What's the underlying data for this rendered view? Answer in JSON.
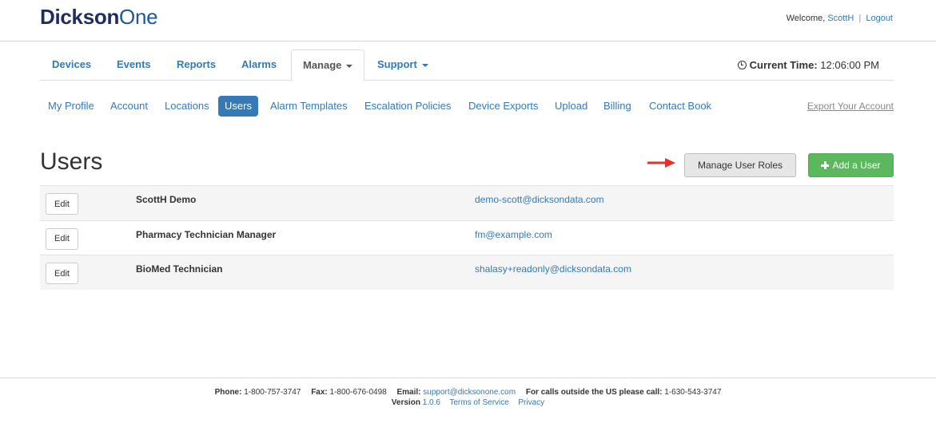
{
  "header": {
    "logo_bold": "Dickson",
    "logo_light": "One",
    "welcome_text": "Welcome,",
    "user_link": "ScottH",
    "separator": "|",
    "logout_link": "Logout"
  },
  "main_nav": {
    "tabs": [
      {
        "label": "Devices"
      },
      {
        "label": "Events"
      },
      {
        "label": "Reports"
      },
      {
        "label": "Alarms"
      },
      {
        "label": "Manage",
        "active": true,
        "dropdown": true
      },
      {
        "label": "Support",
        "dropdown": true
      }
    ],
    "clock_label": "Current Time:",
    "clock_value": "12:06:00 PM"
  },
  "sub_nav": {
    "items": [
      {
        "label": "My Profile"
      },
      {
        "label": "Account"
      },
      {
        "label": "Locations"
      },
      {
        "label": "Users",
        "active": true
      },
      {
        "label": "Alarm Templates"
      },
      {
        "label": "Escalation Policies"
      },
      {
        "label": "Device Exports"
      },
      {
        "label": "Upload"
      },
      {
        "label": "Billing"
      },
      {
        "label": "Contact Book"
      }
    ],
    "export_link": "Export Your Account"
  },
  "page": {
    "title": "Users",
    "manage_roles_label": "Manage User Roles",
    "add_user_label": "Add a User"
  },
  "users": [
    {
      "edit_label": "Edit",
      "name": "ScottH Demo",
      "email": "demo-scott@dicksondata.com"
    },
    {
      "edit_label": "Edit",
      "name": "Pharmacy Technician Manager",
      "email": "fm@example.com"
    },
    {
      "edit_label": "Edit",
      "name": "BioMed Technician",
      "email": "shalasy+readonly@dicksondata.com"
    }
  ],
  "footer": {
    "phone_label": "Phone:",
    "phone": "1-800-757-3747",
    "fax_label": "Fax:",
    "fax": "1-800-676-0498",
    "email_label": "Email:",
    "email": "support@dicksonone.com",
    "intl_label": "For calls outside the US please call:",
    "intl_phone": "1-630-543-3747",
    "version_label": "Version",
    "version": "1.0.6",
    "terms": "Terms of Service",
    "privacy": "Privacy"
  },
  "colors": {
    "link": "#337ab7",
    "active_pill": "#337ab7",
    "add_button": "#5cb85c",
    "annotation_arrow": "#e8302a",
    "logo_dark": "#1f2d5c"
  }
}
